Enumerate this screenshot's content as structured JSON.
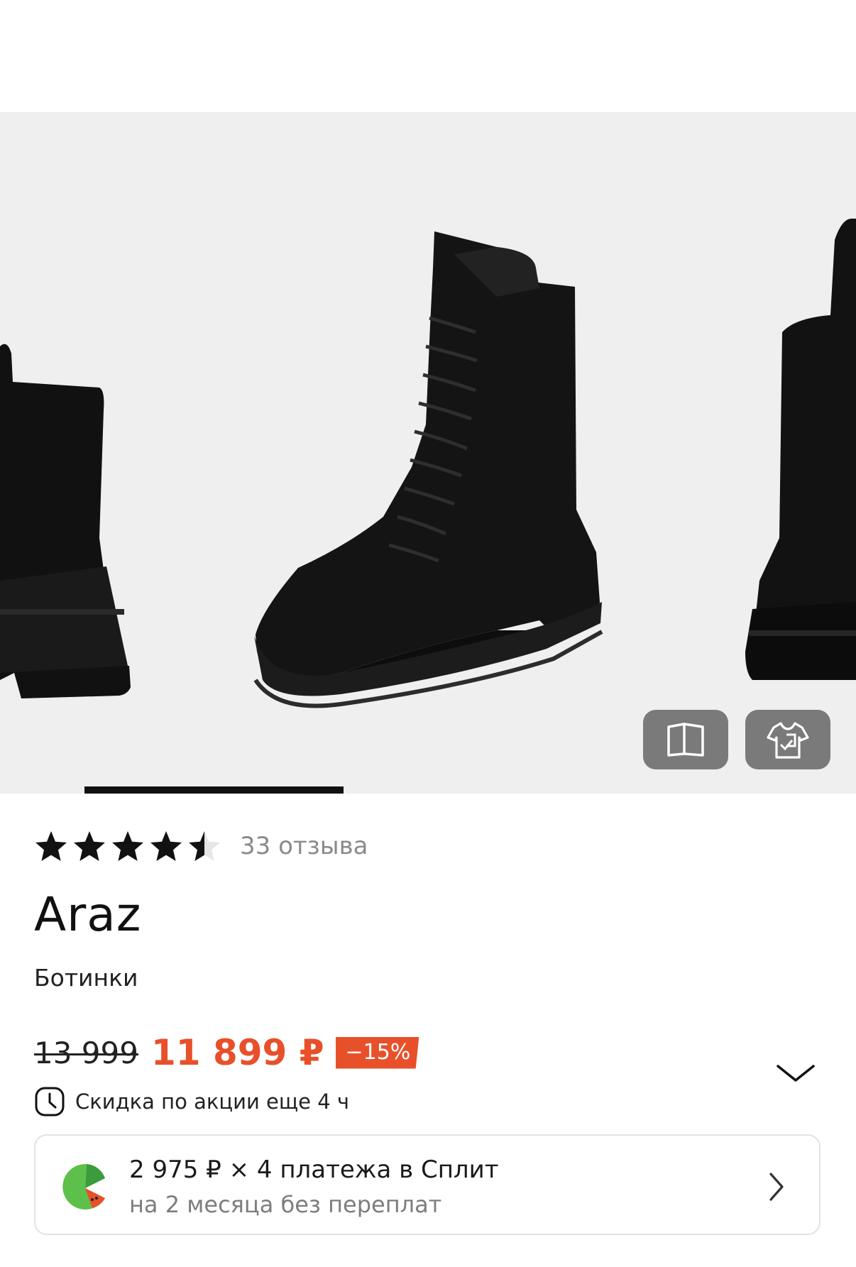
{
  "product": {
    "rating": 4.5,
    "reviews_label": "33 отзыва",
    "brand": "Araz",
    "category": "Ботинки"
  },
  "gallery": {
    "buttons": [
      {
        "icon": "brochure-icon"
      },
      {
        "icon": "try-on-icon"
      }
    ]
  },
  "price": {
    "old": "13 999",
    "current": "11 899 ₽",
    "discount": "−15%",
    "promo": "Скидка по акции еще 4 ч"
  },
  "split": {
    "title": "2 975 ₽ × 4 платежа в Сплит",
    "subtitle": "на 2 месяца без переплат"
  },
  "colors": {
    "accent": "#e8502a",
    "gallery_bg": "#efefef",
    "muted_text": "#8a8a8a",
    "split_green": "#5cc04a"
  }
}
